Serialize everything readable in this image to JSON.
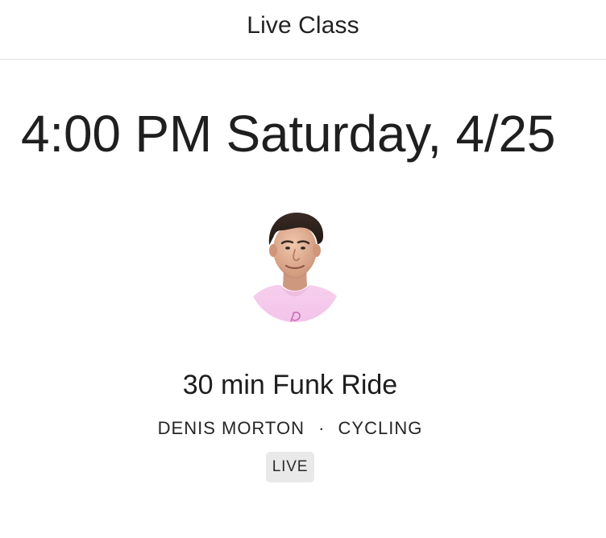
{
  "header": {
    "title": "Live Class"
  },
  "schedule": {
    "datetime": "4:00 PM Saturday, 4/25"
  },
  "class": {
    "title": "30 min Funk Ride",
    "instructor": "DENIS MORTON",
    "separator": "·",
    "discipline": "CYCLING",
    "badge": "LIVE",
    "avatar_icon": "instructor-avatar"
  },
  "colors": {
    "text": "#222222",
    "divider": "#e3e3e3",
    "badge_bg": "#e9e9ea",
    "shirt": "#f4c7e8"
  }
}
